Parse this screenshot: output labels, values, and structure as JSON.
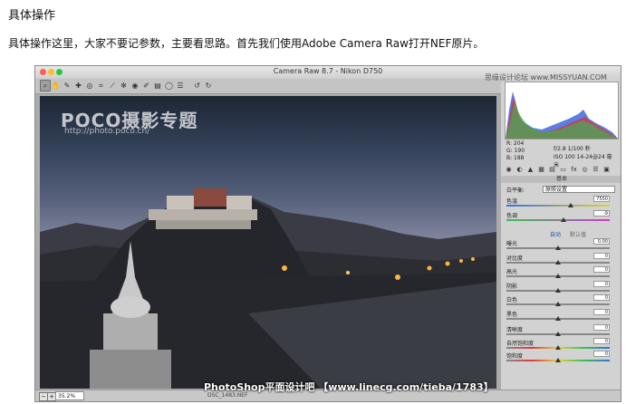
{
  "page": {
    "heading": "具体操作",
    "intro": "具体操作这里，大家不要记参数，主要看思路。首先我们使用Adobe Camera Raw打开NEF原片。",
    "footer_watermark": "PhotoShop平面设计吧 【www.linecg.com/tieba/1783】"
  },
  "window": {
    "title": "Camera Raw 8.7 - Nikon D750",
    "corner_watermark": "思缘设计论坛 www.MISSYUAN.COM"
  },
  "toolbar": {
    "tools": [
      {
        "name": "zoom-tool-icon",
        "glyph": "⌕"
      },
      {
        "name": "hand-tool-icon",
        "glyph": "✋"
      },
      {
        "name": "white-balance-tool-icon",
        "glyph": "✎"
      },
      {
        "name": "color-sampler-tool-icon",
        "glyph": "✚"
      },
      {
        "name": "targeted-adjustment-tool-icon",
        "glyph": "◎"
      },
      {
        "name": "crop-tool-icon",
        "glyph": "⌗"
      },
      {
        "name": "straighten-tool-icon",
        "glyph": "⟋"
      },
      {
        "name": "spot-removal-tool-icon",
        "glyph": "✻"
      },
      {
        "name": "red-eye-tool-icon",
        "glyph": "◉"
      },
      {
        "name": "adjustment-brush-icon",
        "glyph": "✐"
      },
      {
        "name": "graduated-filter-icon",
        "glyph": "▤"
      },
      {
        "name": "radial-filter-icon",
        "glyph": "◯"
      },
      {
        "name": "preferences-icon",
        "glyph": "☰"
      },
      {
        "name": "rotate-ccw-icon",
        "glyph": "↺"
      },
      {
        "name": "rotate-cw-icon",
        "glyph": "↻"
      }
    ]
  },
  "photo": {
    "logo": "POCO摄影专题",
    "url": "http://photo.poco.cn/"
  },
  "bottombar": {
    "zoom_minus": "−",
    "zoom_plus": "+",
    "zoom": "35.2%",
    "filename": "DSC_1483.NEF"
  },
  "panel": {
    "readout": {
      "r": "R: 204",
      "g": "G: 190",
      "b": "B: 188",
      "exposure_info": "f/2.8   1/100 秒",
      "iso_info": "ISO 100   14-24@24 毫米"
    },
    "section_title": "基本",
    "white_balance": {
      "label": "白平衡:",
      "value": "原照设置"
    },
    "sliders_wb": [
      {
        "name": "temperature",
        "label": "色温",
        "value": "7550",
        "knob": 0.62
      },
      {
        "name": "tint",
        "label": "色调",
        "value": "-9",
        "knob": 0.55
      }
    ],
    "subtabs": {
      "auto": "自动",
      "default": "默认值"
    },
    "sliders_tone": [
      {
        "name": "exposure",
        "label": "曝光",
        "value": "0.00",
        "knob": 0.5
      },
      {
        "name": "contrast",
        "label": "对比度",
        "value": "0",
        "knob": 0.5
      },
      {
        "name": "highlights",
        "label": "高光",
        "value": "0",
        "knob": 0.5
      },
      {
        "name": "shadows",
        "label": "阴影",
        "value": "0",
        "knob": 0.5
      },
      {
        "name": "whites",
        "label": "白色",
        "value": "0",
        "knob": 0.5
      },
      {
        "name": "blacks",
        "label": "黑色",
        "value": "0",
        "knob": 0.5
      }
    ],
    "sliders_presence": [
      {
        "name": "clarity",
        "label": "清晰度",
        "value": "0",
        "knob": 0.5
      },
      {
        "name": "vibrance",
        "label": "自然饱和度",
        "value": "0",
        "knob": 0.5
      },
      {
        "name": "saturation",
        "label": "饱和度",
        "value": "0",
        "knob": 0.5
      }
    ],
    "panel_icons": [
      "basic-icon",
      "tone-curve-icon",
      "detail-icon",
      "hsl-icon",
      "split-toning-icon",
      "lens-icon",
      "fx-icon",
      "camera-calibration-icon",
      "presets-icon",
      "snapshots-icon"
    ]
  }
}
